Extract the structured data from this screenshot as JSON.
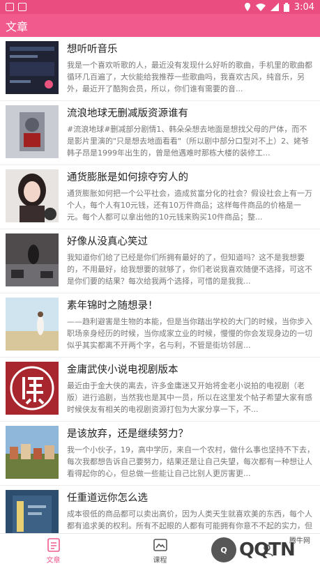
{
  "status": {
    "time": "3:04"
  },
  "appbar": {
    "title": "文章"
  },
  "articles": [
    {
      "title": "想听听音乐",
      "desc": "我是一个喜欢听歌的人，最近没有发现什么好听的歌曲，手机里的歌曲都循环几百遍了，大伙能给我推荐一些歌曲吗，我喜欢古风，纯音乐，另外，最近开了酷狗会员，所以，你们谁有需要的音..."
    },
    {
      "title": "流浪地球无删减版资源谁有",
      "desc": "#流浪地球#删减部分剧情1、韩朵朵想去地面是想找父母的尸体，而不是影片里演的\"只是想去地面看看\"（所以剧中部分口型对不上）2、姥爷韩子昂是1999年出生的，曾是他遇难时那栋大楼的装修工..."
    },
    {
      "title": "通货膨胀是如何掠夺穷人的",
      "desc": "通货膨胀如何把一个公平社会，造成贫富分化的社会？假设社会上有一万个人，每个人有10元钱，还有10万件商品；这样每件商品的价格是一元。每个人都可以拿出他的10元钱来购买10件商品；整..."
    },
    {
      "title": "好像从没真心笑过",
      "desc": "我知道你们给了已经是你们所拥有最好的了，但知道吗？这不是我想要的，不用最好，给我想要的就够了，你们老说我喜欢随便不选择，可这不是你们要的结果？每次给我两个选择，可惜的是我我..."
    },
    {
      "title": "素年锦时之随想录！",
      "desc": "——趋利避害是生物的本能，但是当你踏出学校的大门的时候，当你步入职场亲身经历的时候，当你成家立业的时候，慢慢的你会发现身边的一切似乎其实都离不开两个字，名与利，不管是街坊邻居..."
    },
    {
      "title": "金庸武侠小说电视剧版本",
      "desc": "最近由于金大侠的离去，许多金庸迷又开始将金老小说拍的电视剧（老版）进行追剧，当然我也是其中一员，所以在这里发个帖子希望大家有感时候侠友有相关的电视剧资源打包为大家分享一下，不..."
    },
    {
      "title": "是该放弃，还是继续努力？",
      "desc": "我一个小伙子，19，高中学历，来自一个农村，做什么事也坚持不下去，每次我都想告诉自己要努力，结果还是让自己失望，每次都有一种想让人看得起你的心，但总做一些能让自己比别人更厉害更..."
    },
    {
      "title": "任重道远你怎么选",
      "desc": "成本很低的商品都可以卖出高价，因为人类天生就喜欢美的东西，每个人都有追求美的权利。所有不起眼的人都有可能拥有你意不不起的实力，但是没有实力就拥有一切，你认为让人看得起，没有不选..."
    }
  ],
  "tabs": [
    {
      "label": "文章",
      "icon": "article-icon"
    },
    {
      "label": "课程",
      "icon": "course-icon"
    },
    {
      "label": "",
      "icon": "mine-icon"
    }
  ],
  "watermark": {
    "brand": "QQTN",
    "cn": "腾牛网"
  }
}
